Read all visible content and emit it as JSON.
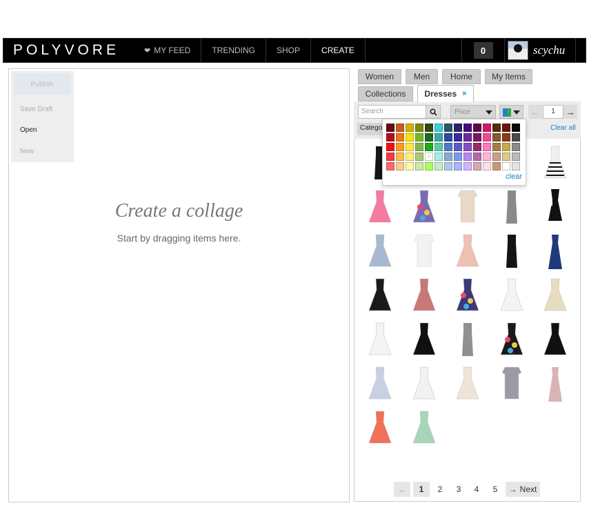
{
  "nav": {
    "logo": "POLYVORE",
    "my_feed": "MY FEED",
    "trending": "TRENDING",
    "shop": "SHOP",
    "create": "CREATE",
    "cart_count": "0",
    "username": "scychu"
  },
  "editor": {
    "publish": "Publish",
    "save_draft": "Save Draft",
    "open": "Open",
    "new": "New",
    "title": "Create a collage",
    "subtitle": "Start by dragging items here."
  },
  "tabs": {
    "row1": [
      "Women",
      "Men",
      "Home",
      "My Items"
    ],
    "collections": "Collections",
    "active": "Dresses",
    "close": "×"
  },
  "filters": {
    "search_placeholder": "Search",
    "price_placeholder": "Price",
    "page": "1",
    "category": "Category",
    "clear_all": "Clear all"
  },
  "color_picker": {
    "clear": "clear",
    "none_mark": "×",
    "colors": [
      [
        "#6b0a12",
        "#cc5a1e",
        "#d4b10a",
        "#7a8a0c",
        "#2f4a0c",
        "#3cd0d8",
        "#245a6a",
        "#2a246a",
        "#4a0c7a",
        "#5a0c4a",
        "#d0186a",
        "#5a2a0a",
        "#6a180a",
        "#0a0a0a"
      ],
      [
        "#b40e1e",
        "#ee7a0e",
        "#f2e40a",
        "#7ab42a",
        "#1e6a1e",
        "#3ca8a8",
        "#2a4aa0",
        "#3a2aa0",
        "#6a2aa0",
        "#7a1a5a",
        "#ee4a9a",
        "#8a5a2a",
        "#8a3a1a",
        "#4a4a4a"
      ],
      [
        "#ee1212",
        "#ff9a1e",
        "#ffe44a",
        "#8ab44a",
        "#1ea81e",
        "#5acaa8",
        "#4a7ac8",
        "#5a5ac8",
        "#8a4ac8",
        "#9a2a6a",
        "#ff7aba",
        "#aa7a4a",
        "#c8a84a",
        "#8a8a8a"
      ],
      [
        "#ee3a4a",
        "#ffba4a",
        "#fff07a",
        "#aac87a",
        "#4aca4a",
        "#aaeaea",
        "#8aaac8",
        "#7a9ae8",
        "#b48ae8",
        "#b46aaa",
        "#ffb4d4",
        "#caa08a",
        "#d8ca8a",
        "#bababa"
      ],
      [
        "#ff6a6a",
        "#ffca8a",
        "#fff8aa",
        "#caeaaa",
        "#aaff5a",
        "#cae8ca",
        "#aacaea",
        "#aab4ff",
        "#d0b4ff",
        "#d4a8b4",
        "#ffe0ea",
        "#c89a7a",
        "#ffffff",
        "#e4e4e4"
      ]
    ]
  },
  "pagination": {
    "prev": "←",
    "pages": [
      "1",
      "2",
      "3",
      "4",
      "5"
    ],
    "current": "1",
    "next": "Next",
    "next_arrow": "→"
  },
  "products": [
    {
      "color": "#151515",
      "style": "slip"
    },
    {
      "color": "#eeeeee",
      "style": "tee"
    },
    {
      "color": "#9dd4c0",
      "style": "flare"
    },
    {
      "color": "#f0e6dc",
      "style": "print"
    },
    {
      "color": "#f0f0f0",
      "style": "stripe"
    },
    {
      "color": "#f47aa0",
      "style": "flare"
    },
    {
      "color": "#7a6ab4",
      "style": "print"
    },
    {
      "color": "#e8d8c8",
      "style": "shift"
    },
    {
      "color": "#8a8a88",
      "style": "slip"
    },
    {
      "color": "#111111",
      "style": "cutout"
    },
    {
      "color": "#a8b8d0",
      "style": "flare"
    },
    {
      "color": "#f2f2f2",
      "style": "shift"
    },
    {
      "color": "#f0c0b4",
      "style": "flare"
    },
    {
      "color": "#141414",
      "style": "bodycon"
    },
    {
      "color": "#1e3a7a",
      "style": "gown"
    },
    {
      "color": "#1a1a1a",
      "style": "flare"
    },
    {
      "color": "#c87878",
      "style": "flare"
    },
    {
      "color": "#3a3a7a",
      "style": "print"
    },
    {
      "color": "#f4f4f4",
      "style": "flare"
    },
    {
      "color": "#e8dcc0",
      "style": "flare"
    },
    {
      "color": "#f4f4f4",
      "style": "flare"
    },
    {
      "color": "#101010",
      "style": "flare"
    },
    {
      "color": "#909090",
      "style": "bodycon"
    },
    {
      "color": "#1a1a1a",
      "style": "print"
    },
    {
      "color": "#101010",
      "style": "flare"
    },
    {
      "color": "#c8d0e4",
      "style": "flare"
    },
    {
      "color": "#f2f2f2",
      "style": "flare"
    },
    {
      "color": "#f0e4d8",
      "style": "flare"
    },
    {
      "color": "#9a9ca4",
      "style": "shift"
    },
    {
      "color": "#d8b4b4",
      "style": "gown"
    },
    {
      "color": "#f07058",
      "style": "flare"
    },
    {
      "color": "#a8d4b8",
      "style": "flare"
    }
  ]
}
